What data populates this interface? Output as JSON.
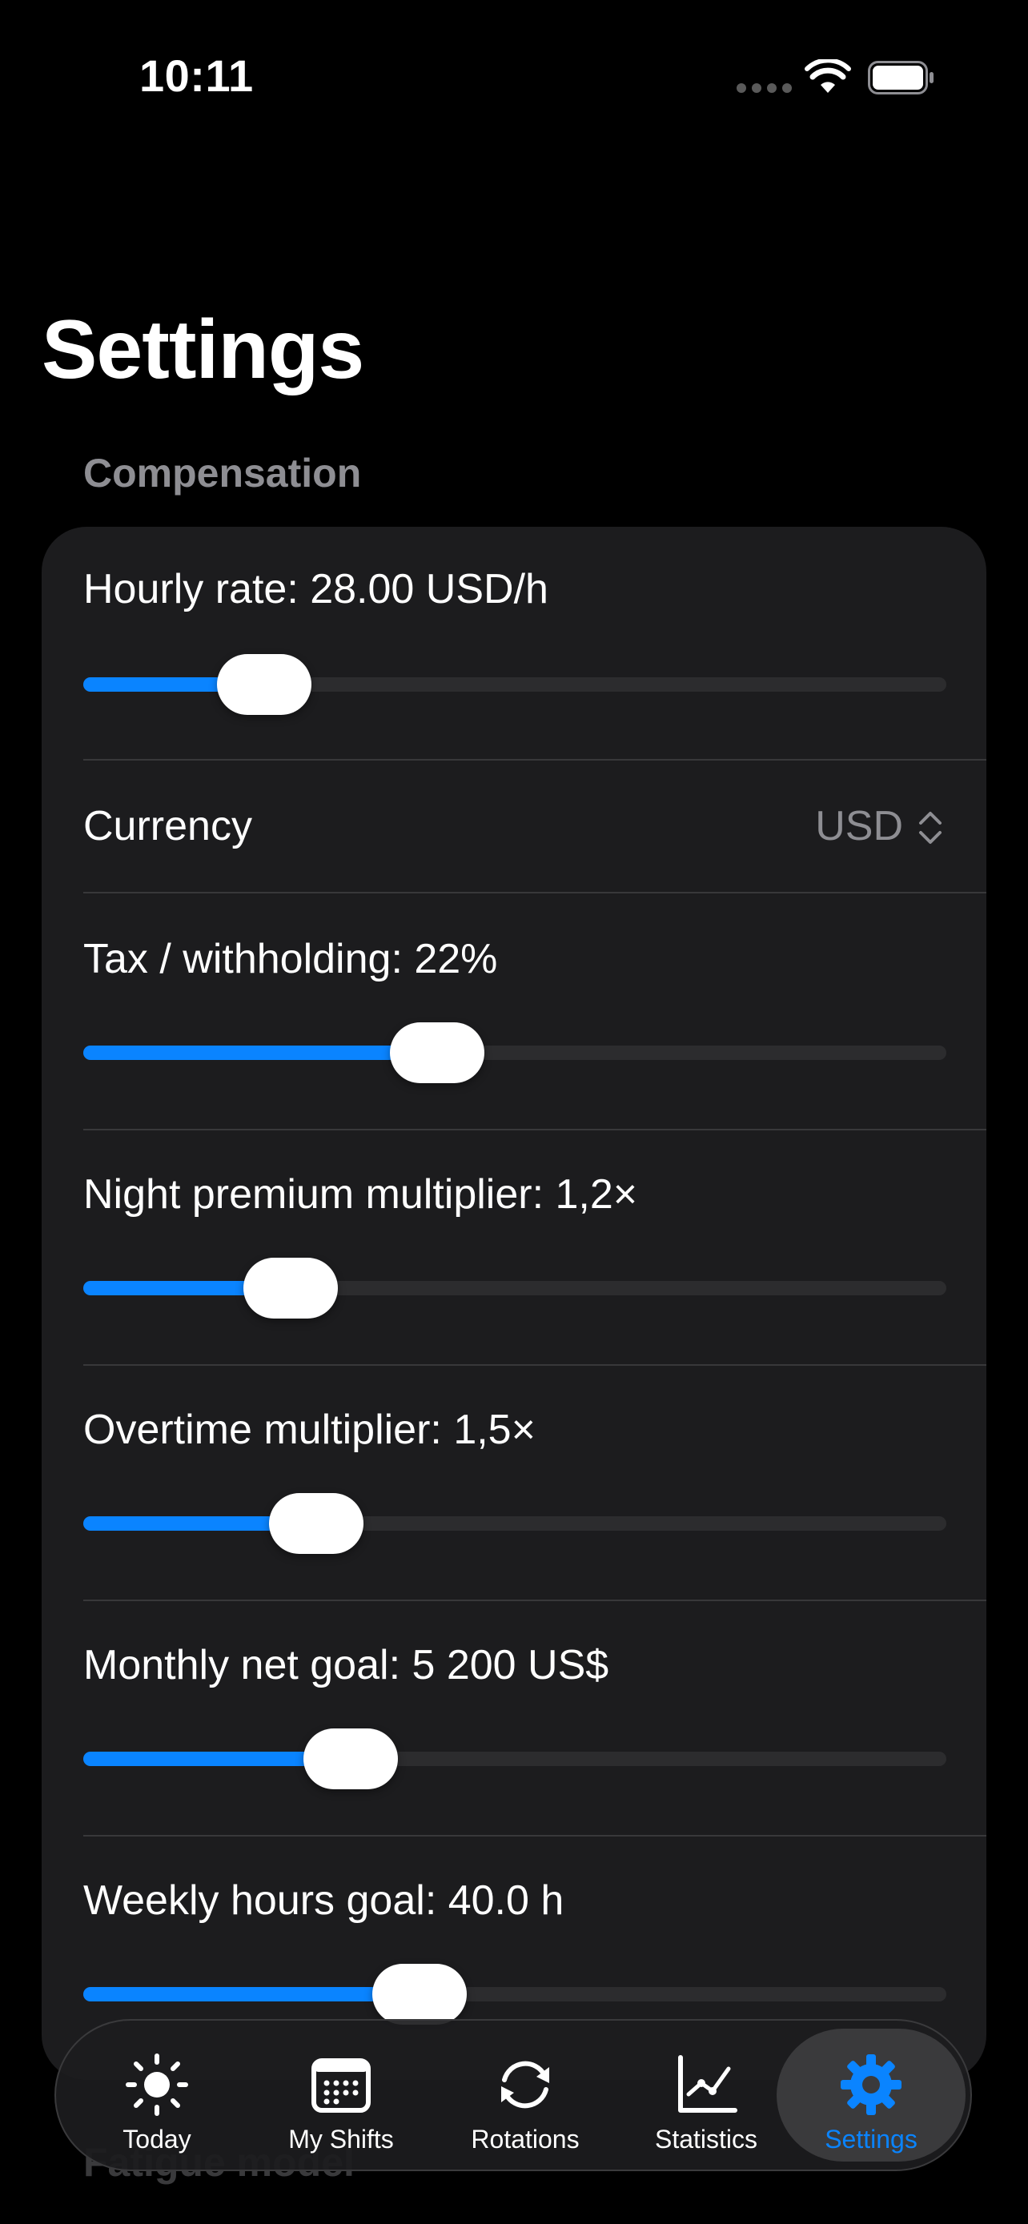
{
  "status_bar": {
    "time": "10:11"
  },
  "header": {
    "title": "Settings"
  },
  "sections": {
    "compensation": "Compensation",
    "fatigue": "Fatigue model"
  },
  "rows": {
    "hourly_rate": {
      "label": "Hourly rate: 28.00 USD/h",
      "level": 0.21
    },
    "currency": {
      "label": "Currency",
      "value": "USD"
    },
    "tax": {
      "label": "Tax / withholding: 22%",
      "level": 0.41
    },
    "night_premium": {
      "label": "Night premium multiplier: 1,2×",
      "level": 0.24
    },
    "overtime": {
      "label": "Overtime multiplier: 1,5×",
      "level": 0.27
    },
    "monthly_goal": {
      "label": "Monthly net goal: 5 200 US$",
      "level": 0.31
    },
    "weekly_hours": {
      "label": "Weekly hours goal: 40.0 h",
      "level": 0.39
    }
  },
  "tabbar": {
    "tabs": [
      {
        "label": "Today",
        "icon": "sun-icon"
      },
      {
        "label": "My Shifts",
        "icon": "calendar-icon"
      },
      {
        "label": "Rotations",
        "icon": "rotate-icon"
      },
      {
        "label": "Statistics",
        "icon": "chart-icon"
      },
      {
        "label": "Settings",
        "icon": "gear-icon",
        "active": true
      }
    ]
  },
  "colors": {
    "accent": "#0a84ff",
    "background": "#000000",
    "card": "#1c1c1e",
    "secondary_text": "#8e8e93"
  }
}
